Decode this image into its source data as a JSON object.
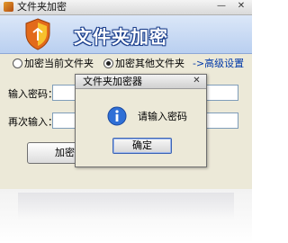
{
  "window": {
    "title": "文件夹加密",
    "minimize_glyph": "—",
    "close_glyph": "✕",
    "app_icon": "folder-lock-icon"
  },
  "banner": {
    "title": "文件夹加密",
    "logo_icon": "shield-icon",
    "shield_colors": {
      "primary": "#e26a1b",
      "accent": "#f7c12d"
    }
  },
  "options": {
    "radio_current": {
      "label": "加密当前文件夹",
      "checked": false
    },
    "radio_other": {
      "label": "加密其他文件夹",
      "checked": true
    },
    "advanced_link": "->高级设置"
  },
  "form": {
    "password_label": "输入密码：",
    "password_value": "",
    "confirm_label": "再次输入：",
    "confirm_value": "",
    "encrypt_button": "加密"
  },
  "dialog": {
    "title": "文件夹加密器",
    "close_glyph": "✕",
    "message": "请输入密码",
    "ok_button": "确定",
    "icon": "info-icon"
  },
  "colors": {
    "banner_title_outline": "#1b3f8c",
    "link": "#0038a8",
    "dialog_ok_border": "#3c64b4"
  }
}
